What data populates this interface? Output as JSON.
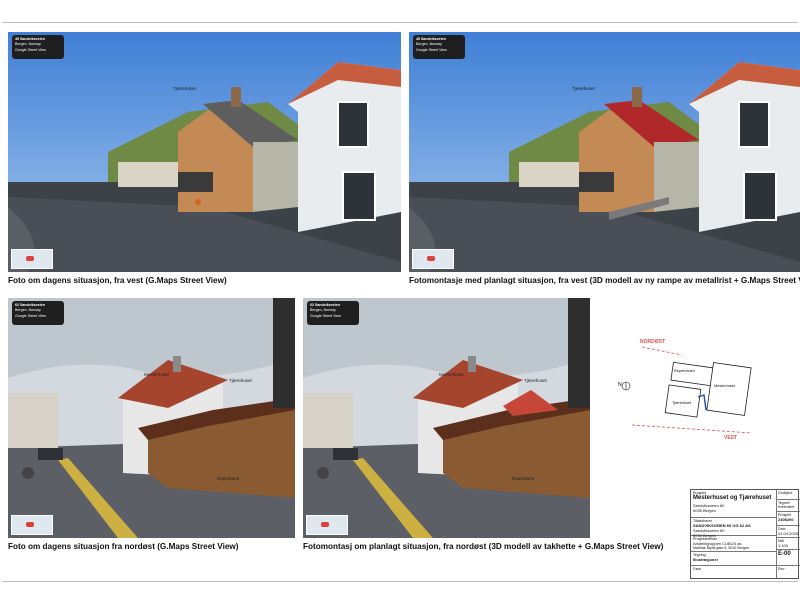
{
  "photos": [
    {
      "caption": "Foto om dagens situasjon, fra vest (G.Maps Street View)",
      "label": "Tjærehuset",
      "roof_color": "#5e5e5e",
      "svbox_title": "45 Sandviksveien",
      "svbox_sub": "Bergen, Norway",
      "svbox_row": "Google Street View"
    },
    {
      "caption": "Fotomontasje med planlagt situasjon, fra vest (3D modell av ny rampe av metallrist + G.Maps Street View)",
      "label": "Tjærehuset",
      "roof_color": "#b1282a",
      "svbox_title": "45 Sandviksveien",
      "svbox_sub": "Bergen, Norway",
      "svbox_row": "Google Street View"
    },
    {
      "caption": "Foto om dagens situasjon fra nordøst (G.Maps Street View)",
      "labels": [
        "Mesterhuset",
        "Tjærehuset",
        "Reperbane"
      ],
      "svbox_title": "62 Sandviksveien",
      "svbox_sub": "Bergen, Norway",
      "svbox_row": "Google Street View"
    },
    {
      "caption": "Fotomontasj om planlagt situasjon, fra nordøst (3D modell av takhette + G.Maps Street View)",
      "labels": [
        "Mesterhuset",
        "Tjærehuset",
        "Reperbane"
      ],
      "svbox_title": "62 Sandviksveien",
      "svbox_sub": "Bergen, Norway",
      "svbox_row": "Google Street View"
    }
  ],
  "sitemap": {
    "north_label": "NORDØST",
    "west_label": "VEST",
    "compass": "N",
    "buildings": [
      "Reperbanen",
      "Mesterhuset",
      "Tjærehuset"
    ]
  },
  "titleblock": {
    "prosjekt_label": "Prosjekt",
    "prosjekt": "Mesterhuset og Tjærehuset",
    "adresse1": "Sandviksveien 60",
    "adresse2": "5035 Bergen",
    "tiltakshaver_label": "Tiltakshaver",
    "tiltakshaver": "SANDVIKSVEIEN 60 OG 62 AS",
    "tiltakshaver_addr": "Sandviksveien 60",
    "tiltakshaver_city": "5035 Bergen",
    "prosjekterende_label": "Prosjekterende",
    "arkitekt": "Arkitektgruppen CUBUS as",
    "arkitekt_addr": "Mathias Blytts gate 8, 5015 Bergen",
    "tegning_label": "Tegning",
    "tegning": "Illustrasjoner",
    "fase_label": "Fase",
    "godkjent_label": "Godkjent",
    "tegnet_label": "Tegnet/ Kontrollert",
    "prosjektnr_label": "Prosjekt",
    "prosjektnr": "2305200",
    "dato_label": "Dato",
    "dato": "01.04.2025",
    "malestokk_label": "Mål",
    "malestokk": "1:100",
    "tegnnr": "E-00",
    "rev_label": "Rev"
  }
}
